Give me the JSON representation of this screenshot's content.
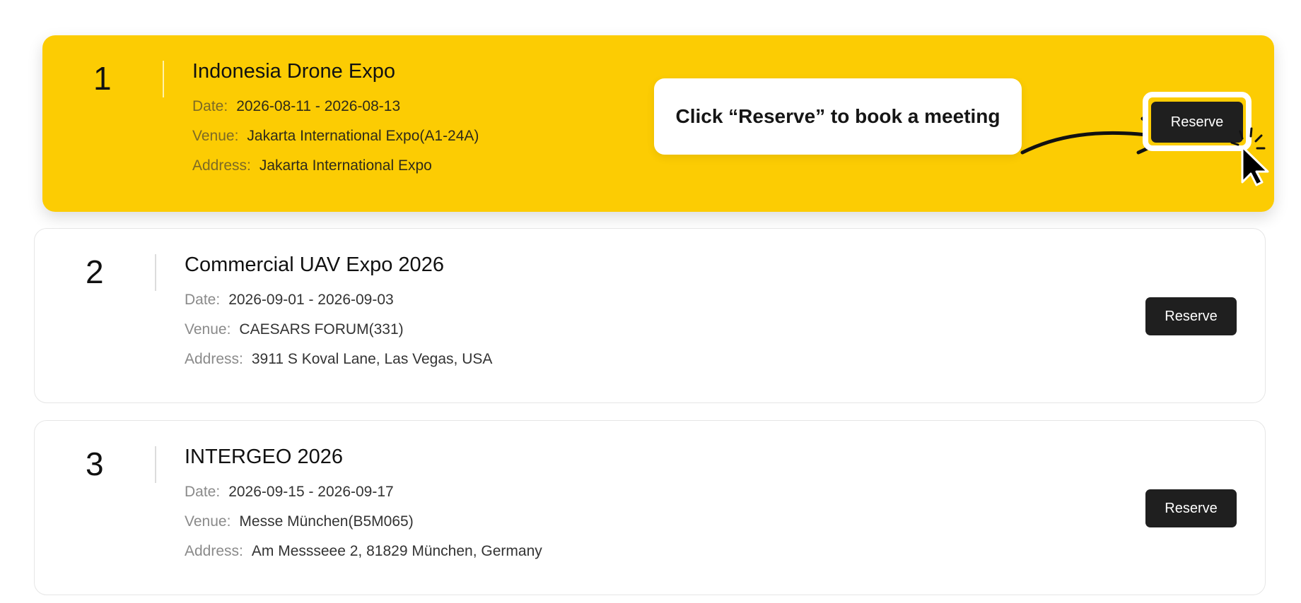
{
  "callout": {
    "text": "Click “Reserve” to book a meeting"
  },
  "labels": {
    "date": "Date:",
    "venue": "Venue:",
    "address": "Address:"
  },
  "events": [
    {
      "number": "1",
      "title": "Indonesia Drone Expo",
      "date": "2026-08-11 - 2026-08-13",
      "venue": "Jakarta International Expo(A1-24A)",
      "address": "Jakarta International Expo",
      "reserve_label": "Reserve",
      "highlighted": true
    },
    {
      "number": "2",
      "title": "Commercial UAV Expo 2026",
      "date": "2026-09-01 - 2026-09-03",
      "venue": "CAESARS FORUM(331)",
      "address": "3911 S Koval Lane, Las Vegas, USA",
      "reserve_label": "Reserve",
      "highlighted": false
    },
    {
      "number": "3",
      "title": "INTERGEO 2026",
      "date": "2026-09-15 - 2026-09-17",
      "venue": "Messe München(B5M065)",
      "address": "Am Messseee 2, 81829 München, Germany",
      "reserve_label": "Reserve",
      "highlighted": false
    }
  ],
  "colors": {
    "highlight": "#fccc03",
    "button": "#1f1f1f",
    "button_text": "#ffffff"
  },
  "icons": {
    "callout_arrow": "curved-arrow-icon",
    "pointer": "mouse-pointer-icon"
  }
}
